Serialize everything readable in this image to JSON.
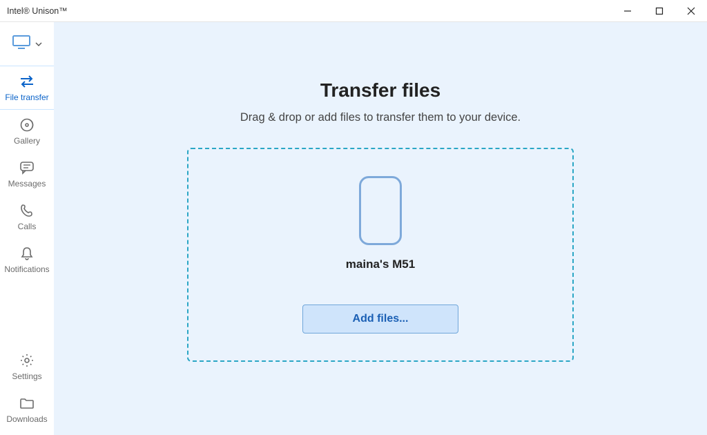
{
  "window": {
    "title": "Intel® Unison™"
  },
  "sidebar": {
    "items": [
      {
        "label": "File transfer"
      },
      {
        "label": "Gallery"
      },
      {
        "label": "Messages"
      },
      {
        "label": "Calls"
      },
      {
        "label": "Notifications"
      },
      {
        "label": "Settings"
      },
      {
        "label": "Downloads"
      }
    ]
  },
  "main": {
    "heading": "Transfer files",
    "subheading": "Drag & drop or add files to transfer them to your device.",
    "device_name": "maina's M51",
    "add_files_label": "Add files..."
  }
}
